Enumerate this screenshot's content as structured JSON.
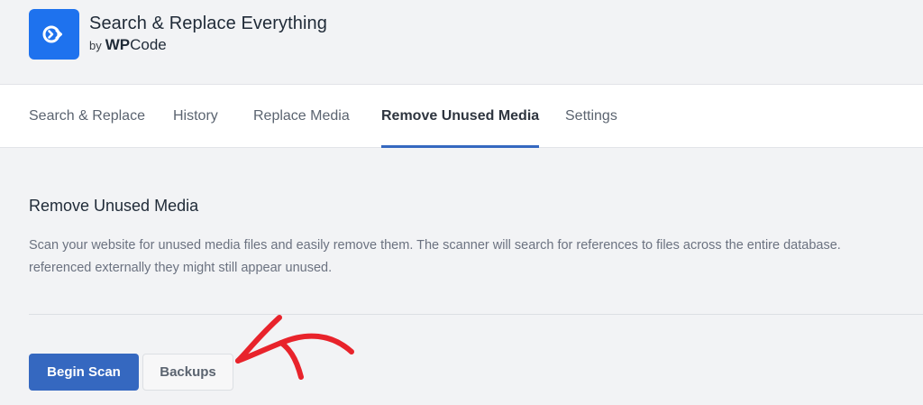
{
  "app": {
    "title": "Search & Replace Everything",
    "by_text": "by",
    "brand_bold": "WP",
    "brand_regular": "Code",
    "logo_icon": "search-replace-logo-icon",
    "accent_color": "#1e72ee"
  },
  "tabs": [
    {
      "label": "Search & Replace",
      "active": false
    },
    {
      "label": "History",
      "active": false
    },
    {
      "label": "Replace Media",
      "active": false
    },
    {
      "label": "Remove Unused Media",
      "active": true
    },
    {
      "label": "Settings",
      "active": false
    }
  ],
  "main": {
    "title": "Remove Unused Media",
    "description_line1": "Scan your website for unused media files and easily remove them. The scanner will search for references to files across the entire database.",
    "description_line2": "referenced externally they might still appear unused.",
    "primary_button": "Begin Scan",
    "secondary_button": "Backups"
  },
  "annotation": {
    "arrow_color": "#e8232b",
    "arrow_icon": "red-arrow-annotation"
  }
}
